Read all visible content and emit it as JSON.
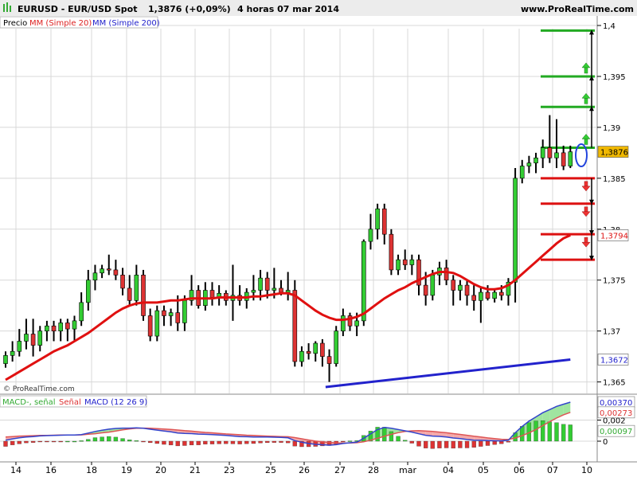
{
  "header": {
    "symbol": "EURUSD - EUR/USD Spot",
    "last_change": "1,3876 (+0,09%)",
    "timeframe_date": "4 horas  07 mar 2014",
    "site": "www.ProRealTime.com"
  },
  "legend_price": {
    "price_label": "Precio",
    "ma20_label": "MM (Simple 20)",
    "ma200_label": "MM (Simple 200)"
  },
  "legend_macd": {
    "macd_signal_label": "MACD-, señal",
    "signal_label": "Señal",
    "macd_label": "MACD (12 26 9)"
  },
  "copyright": "© ProRealTime.com",
  "x_axis_labels": [
    "14",
    "16",
    "18",
    "19",
    "20",
    "21",
    "23",
    "25",
    "26",
    "27",
    "28",
    "mar",
    "04",
    "05",
    "06",
    "07",
    "10"
  ],
  "price_axis_labels": [
    "1,4",
    "1,395",
    "1,39",
    "1,385",
    "1,38",
    "1,375",
    "1,37",
    "1,365"
  ],
  "macd_axis_labels": [
    "0,00370",
    "0,00273",
    "0,002",
    "0,00097",
    "0"
  ],
  "price_tags": {
    "last": "1,3876",
    "ma20": "1,3794",
    "ma200": "1,3672"
  },
  "colors": {
    "up": "#33cc33",
    "down": "#dd3333",
    "ma20": "#e01010",
    "ma200": "#2222cc",
    "last_tag": "#f0b800",
    "grid": "#d8d8d8"
  },
  "chart_data": {
    "type": "candlestick",
    "instrument": "EURUSD",
    "timeframe": "4 horas",
    "ylim": [
      1.3645,
      1.4025
    ],
    "candles": [
      {
        "o": 1.3668,
        "h": 1.368,
        "l": 1.3664,
        "c": 1.3676
      },
      {
        "o": 1.3676,
        "h": 1.369,
        "l": 1.367,
        "c": 1.368
      },
      {
        "o": 1.368,
        "h": 1.3702,
        "l": 1.3675,
        "c": 1.369
      },
      {
        "o": 1.369,
        "h": 1.3712,
        "l": 1.3682,
        "c": 1.3697
      },
      {
        "o": 1.3697,
        "h": 1.3712,
        "l": 1.3675,
        "c": 1.3686
      },
      {
        "o": 1.3686,
        "h": 1.3705,
        "l": 1.368,
        "c": 1.37
      },
      {
        "o": 1.37,
        "h": 1.371,
        "l": 1.369,
        "c": 1.3705
      },
      {
        "o": 1.3705,
        "h": 1.371,
        "l": 1.369,
        "c": 1.37
      },
      {
        "o": 1.37,
        "h": 1.3712,
        "l": 1.369,
        "c": 1.3708
      },
      {
        "o": 1.3708,
        "h": 1.3712,
        "l": 1.369,
        "c": 1.3702
      },
      {
        "o": 1.3702,
        "h": 1.3715,
        "l": 1.369,
        "c": 1.371
      },
      {
        "o": 1.371,
        "h": 1.3738,
        "l": 1.3705,
        "c": 1.3728
      },
      {
        "o": 1.3728,
        "h": 1.376,
        "l": 1.372,
        "c": 1.375
      },
      {
        "o": 1.375,
        "h": 1.3765,
        "l": 1.374,
        "c": 1.3757
      },
      {
        "o": 1.3757,
        "h": 1.3765,
        "l": 1.3752,
        "c": 1.3761
      },
      {
        "o": 1.3761,
        "h": 1.3775,
        "l": 1.3755,
        "c": 1.376
      },
      {
        "o": 1.376,
        "h": 1.377,
        "l": 1.375,
        "c": 1.3755
      },
      {
        "o": 1.3755,
        "h": 1.3762,
        "l": 1.3735,
        "c": 1.3742
      },
      {
        "o": 1.3742,
        "h": 1.3755,
        "l": 1.3725,
        "c": 1.373
      },
      {
        "o": 1.373,
        "h": 1.3765,
        "l": 1.3725,
        "c": 1.3755
      },
      {
        "o": 1.3755,
        "h": 1.376,
        "l": 1.371,
        "c": 1.3715
      },
      {
        "o": 1.3715,
        "h": 1.3722,
        "l": 1.369,
        "c": 1.3695
      },
      {
        "o": 1.3695,
        "h": 1.3725,
        "l": 1.369,
        "c": 1.372
      },
      {
        "o": 1.372,
        "h": 1.3725,
        "l": 1.3705,
        "c": 1.3715
      },
      {
        "o": 1.3715,
        "h": 1.3722,
        "l": 1.3705,
        "c": 1.3718
      },
      {
        "o": 1.3718,
        "h": 1.3735,
        "l": 1.37,
        "c": 1.3708
      },
      {
        "o": 1.3708,
        "h": 1.3735,
        "l": 1.37,
        "c": 1.373
      },
      {
        "o": 1.373,
        "h": 1.3755,
        "l": 1.3725,
        "c": 1.374
      },
      {
        "o": 1.374,
        "h": 1.3745,
        "l": 1.3722,
        "c": 1.3725
      },
      {
        "o": 1.3725,
        "h": 1.3748,
        "l": 1.372,
        "c": 1.374
      },
      {
        "o": 1.374,
        "h": 1.3748,
        "l": 1.3725,
        "c": 1.3733
      },
      {
        "o": 1.3733,
        "h": 1.3745,
        "l": 1.3725,
        "c": 1.3737
      },
      {
        "o": 1.3737,
        "h": 1.374,
        "l": 1.3725,
        "c": 1.373
      },
      {
        "o": 1.373,
        "h": 1.3765,
        "l": 1.371,
        "c": 1.3735
      },
      {
        "o": 1.3735,
        "h": 1.3745,
        "l": 1.3725,
        "c": 1.373
      },
      {
        "o": 1.373,
        "h": 1.3742,
        "l": 1.3722,
        "c": 1.3738
      },
      {
        "o": 1.3738,
        "h": 1.3755,
        "l": 1.373,
        "c": 1.374
      },
      {
        "o": 1.374,
        "h": 1.376,
        "l": 1.373,
        "c": 1.3752
      },
      {
        "o": 1.3752,
        "h": 1.3758,
        "l": 1.3732,
        "c": 1.374
      },
      {
        "o": 1.374,
        "h": 1.3762,
        "l": 1.3732,
        "c": 1.3742
      },
      {
        "o": 1.3742,
        "h": 1.375,
        "l": 1.3735,
        "c": 1.3738
      },
      {
        "o": 1.3738,
        "h": 1.3758,
        "l": 1.373,
        "c": 1.374
      },
      {
        "o": 1.374,
        "h": 1.375,
        "l": 1.3665,
        "c": 1.367
      },
      {
        "o": 1.367,
        "h": 1.3685,
        "l": 1.3665,
        "c": 1.368
      },
      {
        "o": 1.368,
        "h": 1.3688,
        "l": 1.3672,
        "c": 1.3678
      },
      {
        "o": 1.3678,
        "h": 1.369,
        "l": 1.367,
        "c": 1.3688
      },
      {
        "o": 1.3688,
        "h": 1.3692,
        "l": 1.3665,
        "c": 1.3675
      },
      {
        "o": 1.3675,
        "h": 1.3682,
        "l": 1.365,
        "c": 1.3668
      },
      {
        "o": 1.3668,
        "h": 1.3705,
        "l": 1.3665,
        "c": 1.37
      },
      {
        "o": 1.37,
        "h": 1.3722,
        "l": 1.3695,
        "c": 1.3715
      },
      {
        "o": 1.3715,
        "h": 1.3718,
        "l": 1.37,
        "c": 1.3705
      },
      {
        "o": 1.3705,
        "h": 1.3718,
        "l": 1.3695,
        "c": 1.371
      },
      {
        "o": 1.371,
        "h": 1.379,
        "l": 1.3705,
        "c": 1.3788
      },
      {
        "o": 1.3788,
        "h": 1.3815,
        "l": 1.378,
        "c": 1.38
      },
      {
        "o": 1.38,
        "h": 1.3825,
        "l": 1.379,
        "c": 1.382
      },
      {
        "o": 1.382,
        "h": 1.3825,
        "l": 1.3785,
        "c": 1.3795
      },
      {
        "o": 1.3795,
        "h": 1.38,
        "l": 1.3755,
        "c": 1.376
      },
      {
        "o": 1.376,
        "h": 1.3775,
        "l": 1.3755,
        "c": 1.377
      },
      {
        "o": 1.377,
        "h": 1.378,
        "l": 1.376,
        "c": 1.3765
      },
      {
        "o": 1.3765,
        "h": 1.3775,
        "l": 1.3755,
        "c": 1.377
      },
      {
        "o": 1.377,
        "h": 1.3775,
        "l": 1.3735,
        "c": 1.3745
      },
      {
        "o": 1.3745,
        "h": 1.3758,
        "l": 1.3725,
        "c": 1.3735
      },
      {
        "o": 1.3735,
        "h": 1.376,
        "l": 1.373,
        "c": 1.3755
      },
      {
        "o": 1.3755,
        "h": 1.3768,
        "l": 1.3745,
        "c": 1.3762
      },
      {
        "o": 1.3762,
        "h": 1.377,
        "l": 1.3745,
        "c": 1.375
      },
      {
        "o": 1.375,
        "h": 1.3755,
        "l": 1.3725,
        "c": 1.374
      },
      {
        "o": 1.374,
        "h": 1.375,
        "l": 1.373,
        "c": 1.3745
      },
      {
        "o": 1.3745,
        "h": 1.375,
        "l": 1.3725,
        "c": 1.3735
      },
      {
        "o": 1.3735,
        "h": 1.3745,
        "l": 1.372,
        "c": 1.373
      },
      {
        "o": 1.373,
        "h": 1.3742,
        "l": 1.3708,
        "c": 1.3738
      },
      {
        "o": 1.3738,
        "h": 1.3745,
        "l": 1.373,
        "c": 1.3732
      },
      {
        "o": 1.3732,
        "h": 1.3742,
        "l": 1.3728,
        "c": 1.3738
      },
      {
        "o": 1.3738,
        "h": 1.3745,
        "l": 1.373,
        "c": 1.3735
      },
      {
        "o": 1.3735,
        "h": 1.3752,
        "l": 1.3725,
        "c": 1.3748
      },
      {
        "o": 1.3748,
        "h": 1.386,
        "l": 1.3728,
        "c": 1.385
      },
      {
        "o": 1.385,
        "h": 1.3868,
        "l": 1.3845,
        "c": 1.3862
      },
      {
        "o": 1.3862,
        "h": 1.3872,
        "l": 1.3855,
        "c": 1.3865
      },
      {
        "o": 1.3865,
        "h": 1.3875,
        "l": 1.3855,
        "c": 1.387
      },
      {
        "o": 1.387,
        "h": 1.3888,
        "l": 1.386,
        "c": 1.388
      },
      {
        "o": 1.388,
        "h": 1.3912,
        "l": 1.3865,
        "c": 1.387
      },
      {
        "o": 1.387,
        "h": 1.3908,
        "l": 1.386,
        "c": 1.3875
      },
      {
        "o": 1.3875,
        "h": 1.3882,
        "l": 1.3858,
        "c": 1.3862
      },
      {
        "o": 1.3862,
        "h": 1.3882,
        "l": 1.386,
        "c": 1.3876
      }
    ],
    "ma20": [
      1.3652,
      1.3656,
      1.366,
      1.3664,
      1.3668,
      1.3672,
      1.3676,
      1.368,
      1.3683,
      1.3686,
      1.369,
      1.3694,
      1.3698,
      1.3703,
      1.3708,
      1.3713,
      1.3718,
      1.3722,
      1.3725,
      1.3727,
      1.3728,
      1.3728,
      1.3728,
      1.3729,
      1.373,
      1.373,
      1.3731,
      1.3732,
      1.3732,
      1.3732,
      1.3732,
      1.3733,
      1.3733,
      1.3733,
      1.3733,
      1.3733,
      1.3734,
      1.3734,
      1.3735,
      1.3736,
      1.3737,
      1.3737,
      1.3735,
      1.373,
      1.3725,
      1.372,
      1.3716,
      1.3713,
      1.3711,
      1.3711,
      1.3712,
      1.3714,
      1.3717,
      1.3722,
      1.3727,
      1.3732,
      1.3736,
      1.374,
      1.3743,
      1.3747,
      1.375,
      1.3753,
      1.3756,
      1.3758,
      1.3758,
      1.3757,
      1.3754,
      1.375,
      1.3746,
      1.3743,
      1.3741,
      1.3741,
      1.3742,
      1.3745,
      1.375,
      1.3756,
      1.3762,
      1.3768,
      1.3774,
      1.378,
      1.3786,
      1.3791,
      1.3794
    ],
    "ma200": {
      "start_index": 46,
      "start": 1.3645,
      "end": 1.3672
    },
    "horizontal_levels": {
      "resistance": [
        1.3995,
        1.395,
        1.392,
        1.388
      ],
      "support": [
        1.385,
        1.3825,
        1.3795,
        1.377
      ]
    },
    "macd_pane": {
      "ylim": [
        -0.00068,
        0.00412
      ],
      "macd": [
        9e-05,
        0.00022,
        0.00032,
        0.0004,
        0.00044,
        0.0005,
        0.00053,
        0.00055,
        0.00057,
        0.00058,
        0.00058,
        0.00063,
        0.00077,
        0.00092,
        0.00104,
        0.00114,
        0.00121,
        0.00124,
        0.00124,
        0.00126,
        0.00123,
        0.00113,
        0.00105,
        0.00096,
        0.00088,
        0.00078,
        0.00074,
        0.00072,
        0.00067,
        0.00065,
        0.00062,
        0.00058,
        0.00054,
        0.00049,
        0.00044,
        0.00042,
        0.0004,
        0.0004,
        0.00039,
        0.00038,
        0.00036,
        0.00032,
        5e-05,
        -0.0001,
        -0.00022,
        -0.0003,
        -0.00034,
        -0.00038,
        -0.00033,
        -0.00022,
        -0.00015,
        -0.0001,
        0.00028,
        0.0007,
        0.0011,
        0.0013,
        0.00122,
        0.0011,
        0.00098,
        0.00086,
        0.0007,
        0.00056,
        0.00048,
        0.00045,
        0.0004,
        0.0003,
        0.00024,
        0.00016,
        0.0001,
        8e-05,
        5e-05,
        4e-05,
        3e-05,
        0.0001,
        0.0008,
        0.0014,
        0.0019,
        0.0023,
        0.0027,
        0.003,
        0.0033,
        0.0035,
        0.0037
      ],
      "signal": [
        0.0004,
        0.00044,
        0.00048,
        0.0005,
        0.00052,
        0.00054,
        0.00055,
        0.00057,
        0.00058,
        0.00058,
        0.00058,
        0.0006,
        0.00066,
        0.00071,
        0.00079,
        0.00086,
        0.00097,
        0.00108,
        0.00116,
        0.00122,
        0.00124,
        0.00122,
        0.00119,
        0.00115,
        0.00111,
        0.00106,
        0.001,
        0.00095,
        0.00089,
        0.00083,
        0.00079,
        0.00074,
        0.00069,
        0.00065,
        0.00061,
        0.00057,
        0.00054,
        0.00051,
        0.00048,
        0.00046,
        0.00044,
        0.00042,
        0.00034,
        0.00023,
        0.00011,
        1e-05,
        -6e-05,
        -0.00012,
        -0.00016,
        -0.00018,
        -0.00017,
        -0.00014,
        -6e-05,
        0.0001,
        0.00027,
        0.00047,
        0.00065,
        0.00081,
        0.00092,
        0.00098,
        0.001,
        0.00097,
        0.00092,
        0.00086,
        0.0008,
        0.00072,
        0.00064,
        0.00056,
        0.00047,
        0.00039,
        0.00031,
        0.00024,
        0.00018,
        0.00016,
        0.0003,
        0.00052,
        0.0008,
        0.0011,
        0.00148,
        0.00185,
        0.0022,
        0.0025,
        0.00273
      ],
      "histogram_last": 0.00097
    }
  }
}
